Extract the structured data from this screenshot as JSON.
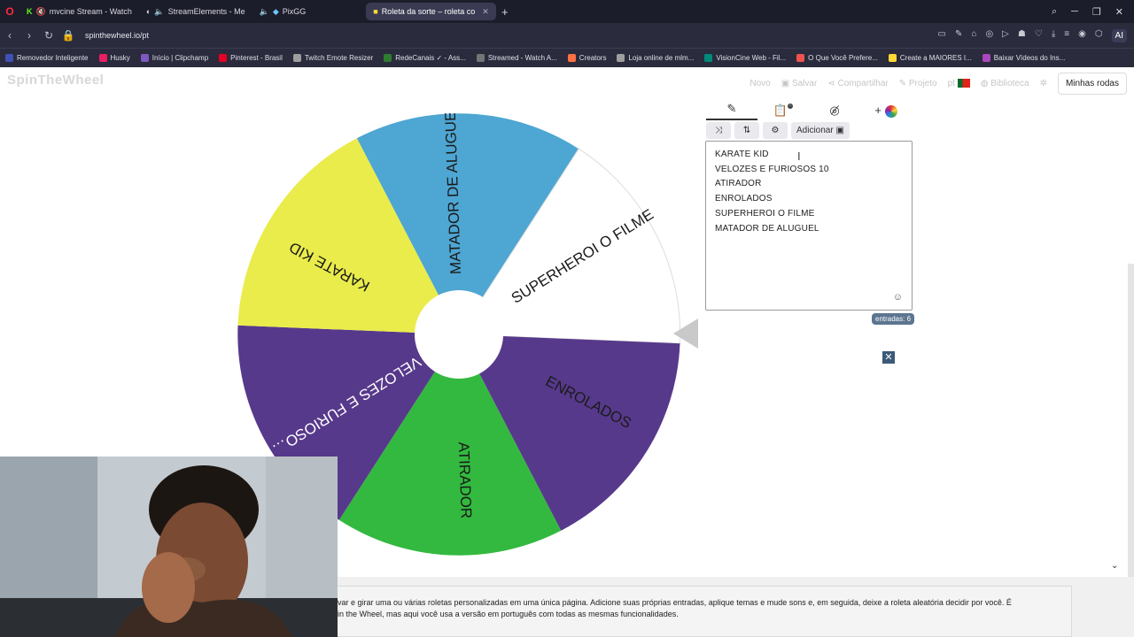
{
  "tabs": [
    {
      "label": "mvcine Stream - Watch",
      "active": false
    },
    {
      "label": "StreamElements - Me",
      "active": false
    },
    {
      "label": "PixGG",
      "active": false
    },
    {
      "label": "Roleta da sorte – roleta co",
      "active": true
    }
  ],
  "address": {
    "url": "spinthewheel.io/pt"
  },
  "bookmarks": [
    {
      "label": "Removedor Inteligente",
      "color": "#3f51b5"
    },
    {
      "label": "Husky",
      "color": "#e91e63"
    },
    {
      "label": "Início | Clipchamp",
      "color": "#7e57c2"
    },
    {
      "label": "Pinterest - Brasil",
      "color": "#e60023"
    },
    {
      "label": "Twitch Emote Resizer",
      "color": "#9e9e9e"
    },
    {
      "label": "RedeCanais ✓ - Ass...",
      "color": "#2e7d32"
    },
    {
      "label": "Streamed - Watch A...",
      "color": "#757575"
    },
    {
      "label": "Creators",
      "color": "#ff7043"
    },
    {
      "label": "Loja online de mlm...",
      "color": "#9e9e9e"
    },
    {
      "label": "VisionCine Web - Fil...",
      "color": "#00897b"
    },
    {
      "label": "O Que Você Prefere...",
      "color": "#ef5350"
    },
    {
      "label": "Create a MAIORES I...",
      "color": "#fdd835"
    },
    {
      "label": "Baixar Vídeos do Ins...",
      "color": "#ab47bc"
    }
  ],
  "header": {
    "logo": "SpinTheWheel",
    "menu": {
      "novo": "Novo",
      "salvar": "Salvar",
      "compartilhar": "Compartilhar",
      "projeto": "Projeto",
      "lang": "pt",
      "biblioteca": "Biblioteca",
      "minhas_rodas": "Minhas rodas"
    }
  },
  "wheel": {
    "segments": [
      {
        "label": "MATADOR DE ALUGUEL",
        "color": "#4ea6d2"
      },
      {
        "label": "SUPERHEROI O FILME",
        "color": "#ffffff"
      },
      {
        "label": "ENROLADOS",
        "color": "#57398b"
      },
      {
        "label": "ATIRADOR",
        "color": "#33b93f"
      },
      {
        "label": "VELOZES E FURIOSO…",
        "color": "#57398b"
      },
      {
        "label": "KARATE KID",
        "color": "#e9ec4b"
      }
    ]
  },
  "editor": {
    "add_label": "Adicionar",
    "entries": [
      "KARATE KID",
      "VELOZES E FURIOSOS 10",
      "ATIRADOR",
      "ENROLADOS",
      "SUPERHEROI O FILME",
      "MATADOR DE ALUGUEL"
    ],
    "counter": "entradas: 6"
  },
  "description": {
    "line1": "var e girar uma ou várias roletas personalizadas em uma única página. Adicione suas próprias entradas, aplique temas e mude sons e, em seguida, deixe a roleta aleatória decidir por você. É",
    "line2": "in the Wheel, mas aqui você usa a versão em português com todas as mesmas funcionalidades."
  }
}
